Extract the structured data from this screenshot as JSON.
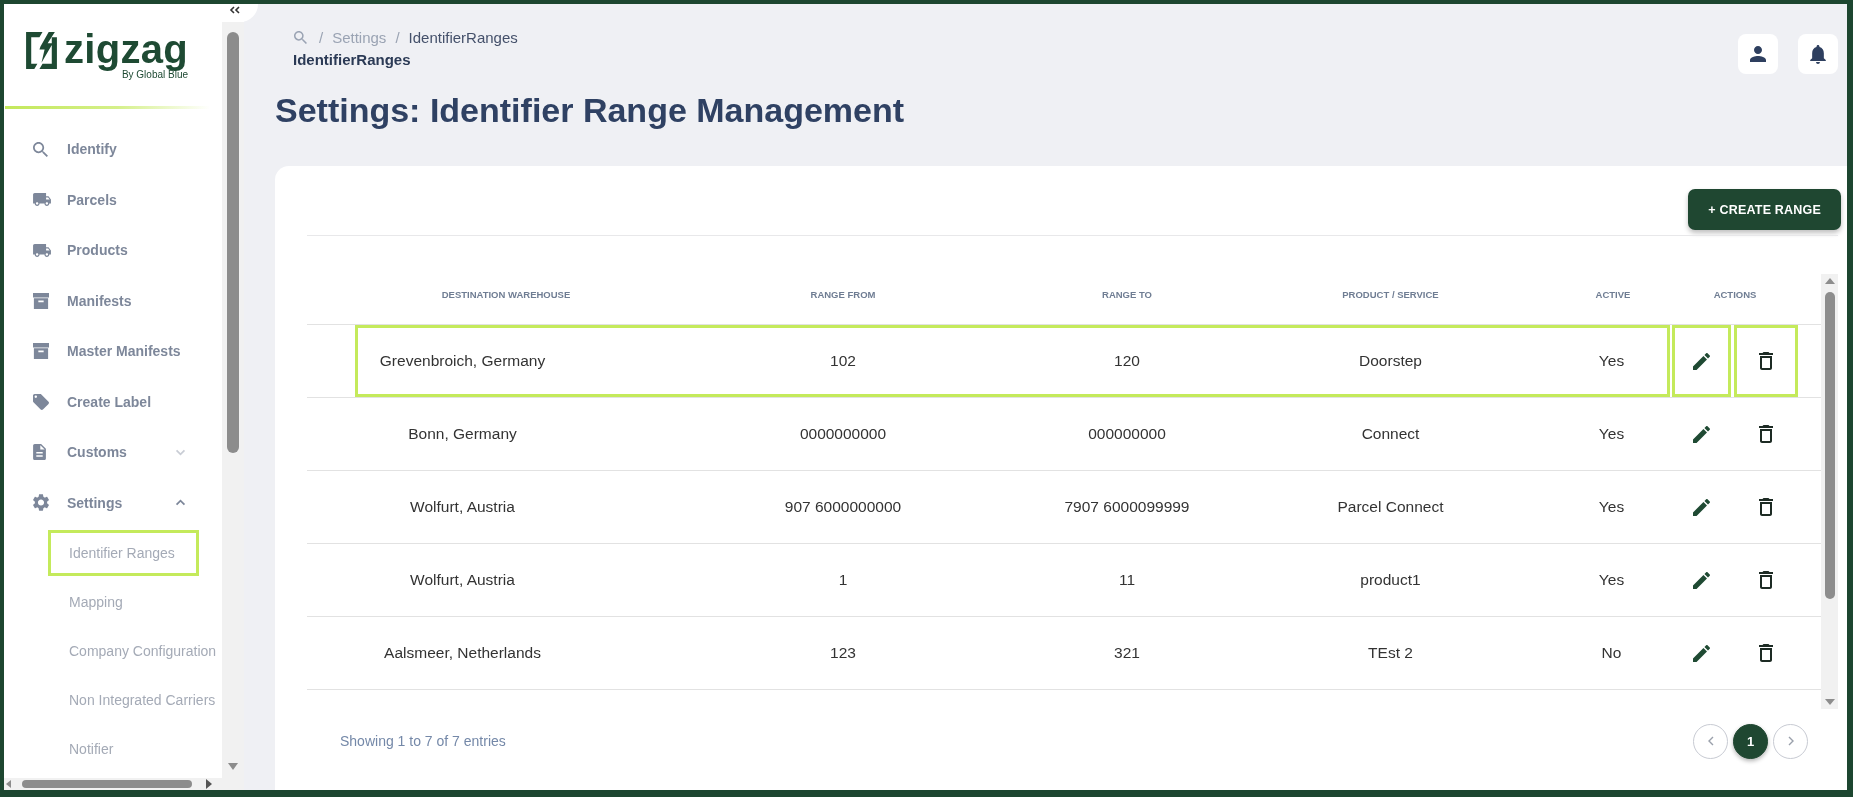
{
  "sidebar": {
    "logo": {
      "wordmark": "zigzag",
      "tagline": "By Global Blue"
    },
    "items": [
      {
        "label": "Identify",
        "kind": "link"
      },
      {
        "label": "Parcels",
        "kind": "link"
      },
      {
        "label": "Products",
        "kind": "link"
      },
      {
        "label": "Manifests",
        "kind": "link"
      },
      {
        "label": "Master Manifests",
        "kind": "link"
      },
      {
        "label": "Create Label",
        "kind": "link"
      },
      {
        "label": "Customs",
        "kind": "group",
        "expanded": false
      },
      {
        "label": "Settings",
        "kind": "group",
        "expanded": true,
        "children": [
          {
            "label": "Identifier Ranges",
            "selected": true
          },
          {
            "label": "Mapping",
            "selected": false
          },
          {
            "label": "Company Configuration",
            "selected": false
          },
          {
            "label": "Non Integrated Carriers",
            "selected": false
          },
          {
            "label": "Notifier",
            "selected": false
          }
        ]
      }
    ]
  },
  "breadcrumb": [
    {
      "kind": "home"
    },
    {
      "kind": "separator",
      "text": "/"
    },
    {
      "kind": "link",
      "text": "Settings"
    },
    {
      "kind": "separator",
      "text": "/"
    },
    {
      "kind": "current",
      "text": "IdentifierRanges"
    }
  ],
  "page_subtitle": "IdentifierRanges",
  "page_title": "Settings: Identifier Range Management",
  "create_button": "+ CREATE RANGE",
  "table": {
    "columns": [
      "DESTINATION WAREHOUSE",
      "RANGE FROM",
      "RANGE TO",
      "PRODUCT / SERVICE",
      "ACTIVE",
      "ACTIONS"
    ],
    "rows": [
      {
        "destination_warehouse": "Grevenbroich, Germany",
        "range_from": "102",
        "range_to": "120",
        "product_service": "Doorstep",
        "active": "Yes",
        "highlighted": true
      },
      {
        "destination_warehouse": "Bonn, Germany",
        "range_from": "0000000000",
        "range_to": "000000000",
        "product_service": "Connect",
        "active": "Yes",
        "highlighted": false
      },
      {
        "destination_warehouse": "Wolfurt, Austria",
        "range_from": "907 6000000000",
        "range_to": "7907 6000099999",
        "product_service": "Parcel Connect",
        "active": "Yes",
        "highlighted": false
      },
      {
        "destination_warehouse": "Wolfurt, Austria",
        "range_from": "1",
        "range_to": "11",
        "product_service": "product1",
        "active": "Yes",
        "highlighted": false
      },
      {
        "destination_warehouse": "Aalsmeer, Netherlands",
        "range_from": "123",
        "range_to": "321",
        "product_service": "TEst 2",
        "active": "No",
        "highlighted": false
      }
    ]
  },
  "footer": {
    "summary": "Showing 1 to 7 of 7 entries",
    "pages": [
      {
        "label": "1",
        "selected": true
      }
    ]
  }
}
